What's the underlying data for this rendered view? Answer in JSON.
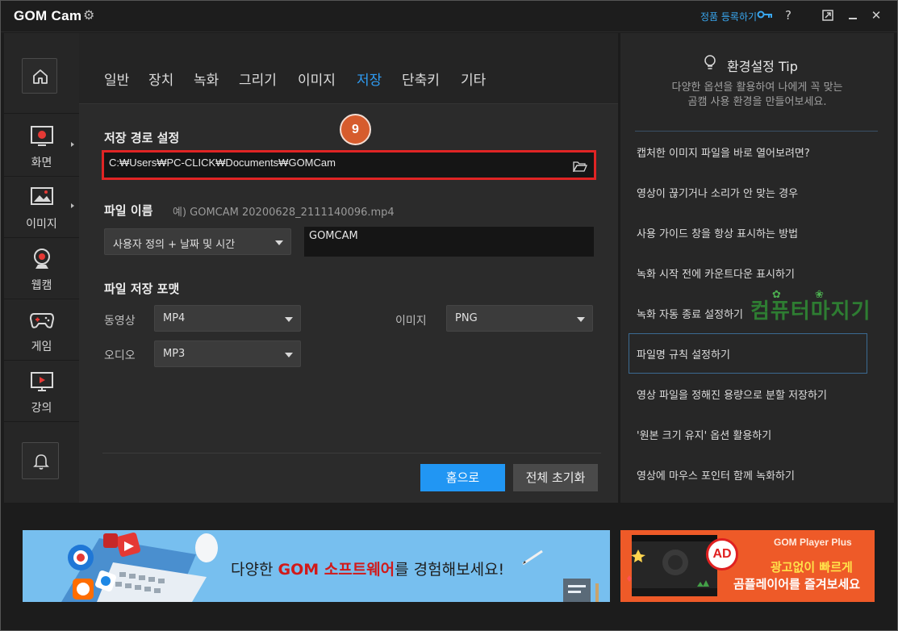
{
  "titlebar": {
    "app_name": "GOM Cam",
    "register_link": "정품 등록하기",
    "help_label": "?",
    "close_label": "✕"
  },
  "sidebar": {
    "items": [
      {
        "label": "화면",
        "icon": "screen-record-icon"
      },
      {
        "label": "이미지",
        "icon": "image-icon"
      },
      {
        "label": "웹캠",
        "icon": "webcam-icon"
      },
      {
        "label": "게임",
        "icon": "gamepad-icon"
      },
      {
        "label": "강의",
        "icon": "lecture-icon"
      }
    ]
  },
  "tabs": [
    "일반",
    "장치",
    "녹화",
    "그리기",
    "이미지",
    "저장",
    "단축키",
    "기타"
  ],
  "active_tab": "저장",
  "save": {
    "path_title": "저장 경로 설정",
    "path_value": "C:₩Users₩PC-CLICK₩Documents₩GOMCam",
    "step_badge": "9",
    "file_name_title": "파일 이름",
    "file_name_example": "예) GOMCAM 20200628_2111140096.mp4",
    "file_name_rule": "사용자 정의 + 날짜 및 시간",
    "file_name_value": "GOMCAM",
    "format_title": "파일 저장 포맷",
    "video_label": "동영상",
    "video_format": "MP4",
    "image_label": "이미지",
    "image_format": "PNG",
    "audio_label": "오디오",
    "audio_format": "MP3",
    "home_button": "홈으로",
    "reset_button": "전체 초기화"
  },
  "tips": {
    "title": "환경설정 Tip",
    "desc_line1": "다양한 옵션을 활용하여 나에게 꼭 맞는",
    "desc_line2": "곰캠 사용 환경을 만들어보세요.",
    "items": [
      "캡처한 이미지 파일을 바로 열어보려면?",
      "영상이 끊기거나 소리가 안 맞는 경우",
      "사용 가이드 창을 항상 표시하는 방법",
      "녹화 시작 전에 카운트다운 표시하기",
      "녹화 자동 종료 설정하기",
      "파일명 규칙 설정하기",
      "영상 파일을 정해진 용량으로 분할 저장하기",
      "'원본 크기 유지' 옵션 활용하기",
      "영상에 마우스 포인터 함께 녹화하기"
    ],
    "watermark": "컴퓨터마지기"
  },
  "banners": {
    "left_text_pre": "다양한 ",
    "left_text_brand": "GOM 소프트웨어",
    "left_text_post": "를 경험해보세요!",
    "right_logo": "GOM Player Plus",
    "right_line1": "광고없이 빠르게",
    "right_line2": "곰플레이어를 즐겨보세요",
    "ad_badge": "AD"
  },
  "colors": {
    "accent": "#2196f3",
    "highlight_border": "#e02424",
    "badge": "#d65c2d"
  }
}
